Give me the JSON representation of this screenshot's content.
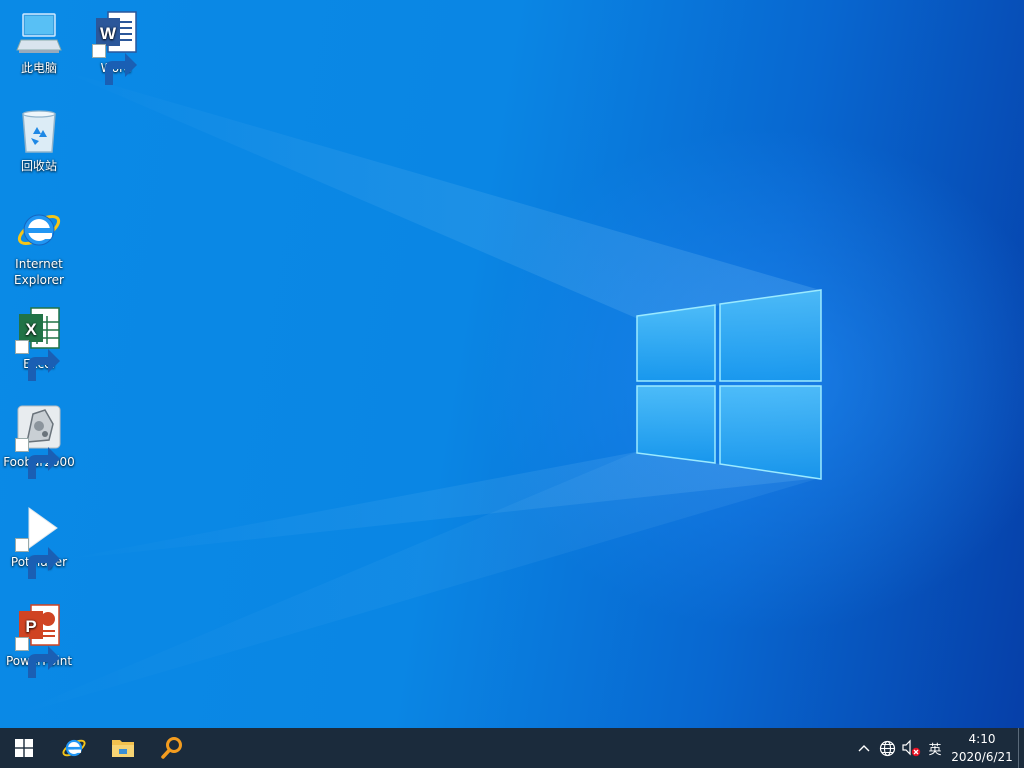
{
  "desktop": {
    "icons": [
      {
        "id": "this-pc",
        "label": "此电脑",
        "icon": "computer-icon",
        "shortcut": false
      },
      {
        "id": "word",
        "label": "Word",
        "icon": "word-icon",
        "shortcut": true
      },
      {
        "id": "recycle-bin",
        "label": "回收站",
        "icon": "recycle-bin-icon",
        "shortcut": false
      },
      {
        "id": "internet-explorer",
        "label": "Internet Explorer",
        "icon": "internet-explorer-icon",
        "shortcut": false
      },
      {
        "id": "excel",
        "label": "Excel",
        "icon": "excel-icon",
        "shortcut": true
      },
      {
        "id": "foobar2000",
        "label": "Foobar2000",
        "icon": "foobar2000-icon",
        "shortcut": true
      },
      {
        "id": "potplayer",
        "label": "PotPlayer",
        "icon": "potplayer-icon",
        "shortcut": true
      },
      {
        "id": "powerpoint",
        "label": "PowerPoint",
        "icon": "powerpoint-icon",
        "shortcut": true
      }
    ]
  },
  "taskbar": {
    "start_icon": "windows-start-icon",
    "pinned": [
      {
        "id": "ie",
        "icon": "internet-explorer-icon"
      },
      {
        "id": "explorer",
        "icon": "file-explorer-icon"
      },
      {
        "id": "search",
        "icon": "search-icon"
      }
    ],
    "tray": {
      "chevron_icon": "chevron-up-icon",
      "network_icon": "network-globe-icon",
      "volume_icon": "volume-muted-icon",
      "ime_label": "英"
    },
    "clock": {
      "time": "4:10",
      "date": "2020/6/21"
    }
  },
  "colors": {
    "wallpaper_blue": "#0a86e4",
    "taskbar": "#1b2b3c",
    "word_blue": "#2b579a",
    "excel_green": "#217346",
    "powerpoint_orange": "#d04423"
  }
}
